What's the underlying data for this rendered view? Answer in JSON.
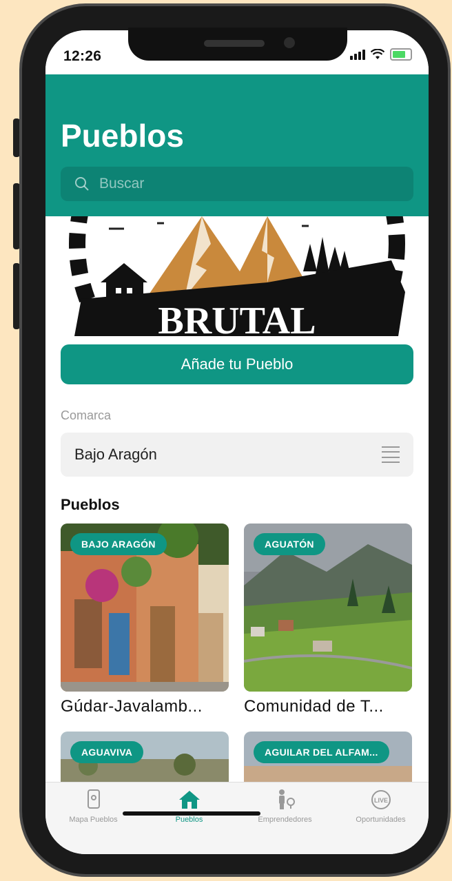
{
  "status": {
    "time": "12:26"
  },
  "header": {
    "title": "Pueblos"
  },
  "search": {
    "placeholder": "Buscar"
  },
  "banner": {
    "text": "BRUTAL"
  },
  "add_button": {
    "label": "Añade tu Pueblo"
  },
  "filter": {
    "label": "Comarca",
    "value": "Bajo Aragón"
  },
  "section": {
    "title": "Pueblos"
  },
  "cards": [
    {
      "tag": "BAJO ARAGÓN",
      "name": "Gúdar-Javalamb..."
    },
    {
      "tag": "AGUATÓN",
      "name": "Comunidad de T..."
    },
    {
      "tag": "AGUAVIVA",
      "name": ""
    },
    {
      "tag": "AGUILAR DEL ALFAM...",
      "name": ""
    }
  ],
  "tabs": [
    {
      "label": "Mapa Pueblos",
      "icon": "map-pin-icon"
    },
    {
      "label": "Pueblos",
      "icon": "home-icon"
    },
    {
      "label": "Emprendedores",
      "icon": "entrepreneur-icon"
    },
    {
      "label": "Oportunidades",
      "icon": "live-icon"
    }
  ],
  "colors": {
    "accent": "#0f9684",
    "background": "#fde6c0"
  }
}
